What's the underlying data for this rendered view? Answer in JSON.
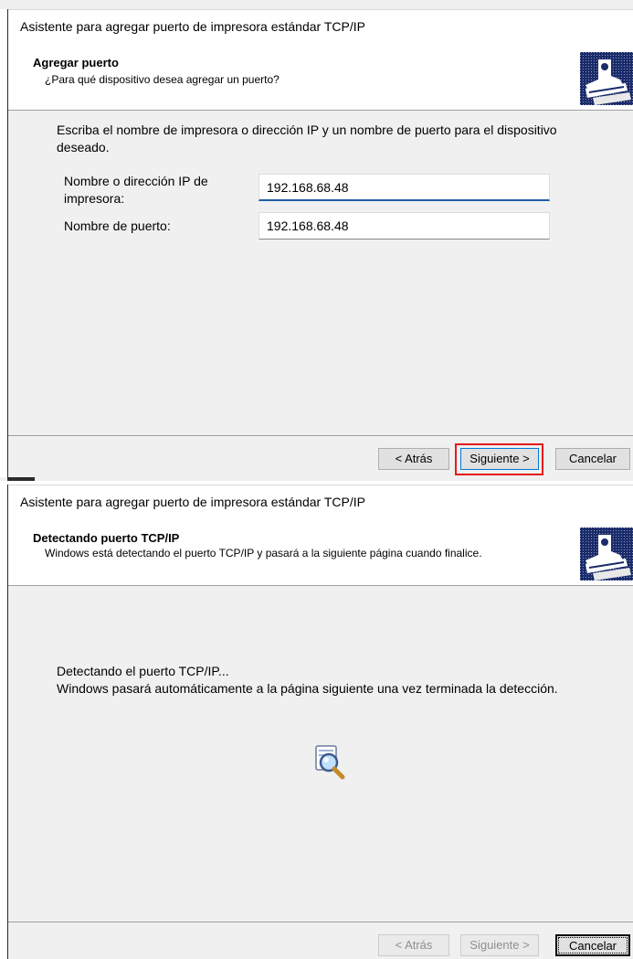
{
  "wizard_add_port": {
    "window_title": "Asistente para agregar puerto de impresora estándar TCP/IP",
    "header": {
      "title": "Agregar puerto",
      "subtitle": "¿Para qué dispositivo desea agregar un puerto?"
    },
    "instruction": "Escriba el nombre de impresora o dirección IP y un nombre de puerto para el dispositivo deseado.",
    "fields": {
      "ip_label": "Nombre o dirección IP de impresora:",
      "ip_value": "192.168.68.48",
      "port_label": "Nombre de puerto:",
      "port_value": "192.168.68.48"
    },
    "buttons": {
      "back": "< Atrás",
      "next": "Siguiente >",
      "cancel": "Cancelar"
    }
  },
  "wizard_detecting": {
    "window_title": "Asistente para agregar puerto de impresora estándar TCP/IP",
    "header": {
      "title": "Detectando puerto TCP/IP",
      "subtitle": "Windows está detectando el puerto TCP/IP y pasará a la siguiente página cuando finalice."
    },
    "message_line1": "Detectando el puerto TCP/IP...",
    "message_line2": "Windows pasará automáticamente a la página siguiente una vez terminada la detección.",
    "buttons": {
      "back": "< Atrás",
      "next": "Siguiente >",
      "cancel": "Cancelar"
    }
  },
  "colors": {
    "highlight": "#e51b1b",
    "focus_underline": "#1f5fa8"
  },
  "icons": [
    "printer-wizard-icon",
    "magnifier-search-icon"
  ]
}
